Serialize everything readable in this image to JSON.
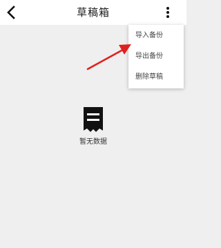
{
  "header": {
    "title": "草稿箱",
    "back_icon": "back-arrow-icon",
    "more_icon": "vertical-dots-icon"
  },
  "menu": {
    "items": [
      {
        "label": "导入备份"
      },
      {
        "label": "导出备份"
      },
      {
        "label": "删除草稿"
      }
    ]
  },
  "empty_state": {
    "icon": "empty-document-icon",
    "text": "暂无数据"
  },
  "annotation": {
    "color": "#e0201e",
    "icon": "red-pointer-arrow"
  },
  "colors": {
    "background": "#efefef",
    "header_background": "#ffffff",
    "menu_background": "#ffffff"
  }
}
